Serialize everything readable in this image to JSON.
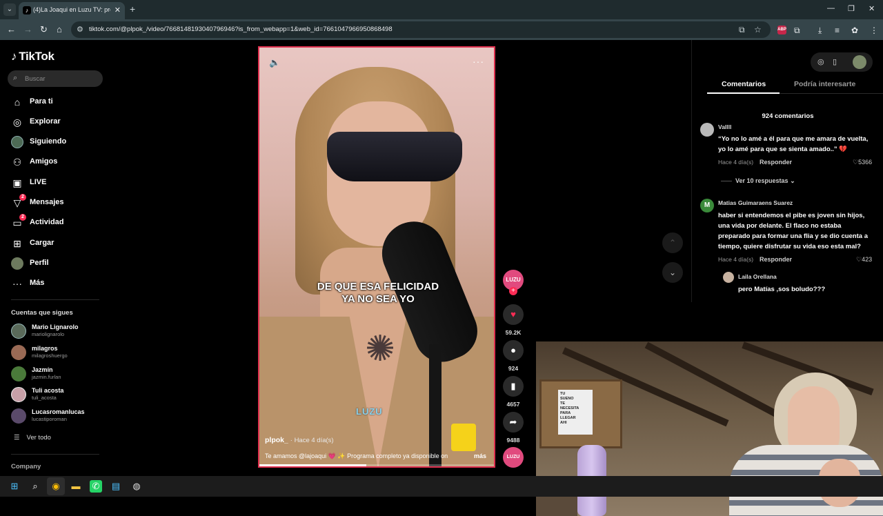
{
  "browser": {
    "tab_title": "(4)La Joaqui en Luzu TV: progra",
    "tab_favicon": "tiktok-icon",
    "url": "tiktok.com/@plpok_/video/7668148193040796946?is_from_webapp=1&web_id=7661047966950868498",
    "abp_label": "ABP"
  },
  "sidebar": {
    "logo_text": "TikTok",
    "search_placeholder": "Buscar",
    "nav": [
      {
        "label": "Para ti",
        "icon": "home-icon"
      },
      {
        "label": "Explorar",
        "icon": "compass-icon"
      },
      {
        "label": "Siguiendo",
        "icon": "following-avatar-icon"
      },
      {
        "label": "Amigos",
        "icon": "friends-icon"
      },
      {
        "label": "LIVE",
        "icon": "live-icon"
      },
      {
        "label": "Mensajes",
        "icon": "messages-icon",
        "badge": "2"
      },
      {
        "label": "Actividad",
        "icon": "activity-icon",
        "badge": "2"
      },
      {
        "label": "Cargar",
        "icon": "upload-icon"
      },
      {
        "label": "Perfil",
        "icon": "profile-avatar-icon"
      },
      {
        "label": "Más",
        "icon": "more-icon"
      }
    ],
    "following_title": "Cuentas que sigues",
    "following": [
      {
        "name": "Mario Lignarolo",
        "handle": "mariolignarolo",
        "color": "#5a6a5a"
      },
      {
        "name": "milagros",
        "handle": "milagroshuergo",
        "color": "#9a6a55"
      },
      {
        "name": "Jazmín",
        "handle": "jazmin.furlan",
        "color": "#4a7a3a"
      },
      {
        "name": "Tuli acosta",
        "handle": "tuli_acosta",
        "color": "#c8a0a8"
      },
      {
        "name": "Lucasromanlucas",
        "handle": "lucastiporoman",
        "color": "#5a4a6a"
      }
    ],
    "see_all": "Ver todo",
    "company": "Company"
  },
  "video": {
    "caption": "DE QUE ESA FELICIDAD\nYA NO SEA YO",
    "watermark": "LUZU",
    "author": "plpok_",
    "posted": "· Hace 4 día(s)",
    "description": "Te amamos @lajoaqui 💗 ✨ Programa completo ya disponible on",
    "more": "más",
    "progress": 0.45
  },
  "actions": {
    "creator_badge": "LUZU",
    "likes": "59.2K",
    "comments": "924",
    "saves": "4657",
    "shares": "9488"
  },
  "comments_panel": {
    "tabs": [
      "Comentarios",
      "Podría interesarte"
    ],
    "count": "924 comentarios",
    "comments": [
      {
        "user": "Vallll",
        "text": "“Yo no lo amé a él para que me amara de vuelta,\nyo lo amé para que se sienta amado..” 💔",
        "time": "Hace 4 día(s)",
        "reply": "Responder",
        "likes": "5366",
        "view_replies": "Ver 10 respuestas"
      },
      {
        "user": "Matias Guimaraens Suarez",
        "initial": "M",
        "text": "haber si entendemos el pibe es joven sin hijos,\nuna vida por delante. El flaco no estaba\npreparado para formar una flia y se dio cuenta a\ntiempo, quiere disfrutar su vida eso esta mal?",
        "time": "Hace 4 día(s)",
        "reply": "Responder",
        "likes": "423"
      },
      {
        "user": "Laila Orellana",
        "text": "pero Matías ,sos boludo???"
      }
    ]
  },
  "webcam": {
    "poster_text": "TU\nSUENO\nTE\nNECESITA\nPARA\nLLEGAR\nAHI"
  },
  "colors": {
    "accent": "#fe2c55",
    "chrome_bg": "#1f2b2e",
    "chrome_bar": "#35454a",
    "matias_avatar": "#3a8a3a"
  }
}
